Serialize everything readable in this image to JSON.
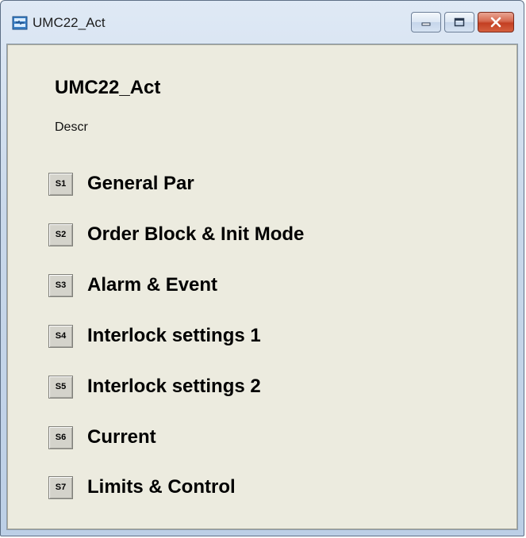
{
  "window": {
    "title": "UMC22_Act",
    "buttons": {
      "minimize_icon": "minimize-icon",
      "maximize_icon": "maximize-icon",
      "close_icon": "close-icon"
    }
  },
  "main": {
    "title": "UMC22_Act",
    "description": "Descr",
    "items": [
      {
        "button": "S1",
        "label": "General Par"
      },
      {
        "button": "S2",
        "label": "Order Block & Init Mode"
      },
      {
        "button": "S3",
        "label": "Alarm & Event"
      },
      {
        "button": "S4",
        "label": "Interlock settings 1"
      },
      {
        "button": "S5",
        "label": "Interlock settings 2"
      },
      {
        "button": "S6",
        "label": "Current"
      },
      {
        "button": "S7",
        "label": "Limits & Control"
      }
    ]
  },
  "colors": {
    "client_background": "#ecebdf",
    "button_face": "#d4d3cb",
    "close_button": "#c33f22",
    "titlebar": "#c9d8ea"
  }
}
